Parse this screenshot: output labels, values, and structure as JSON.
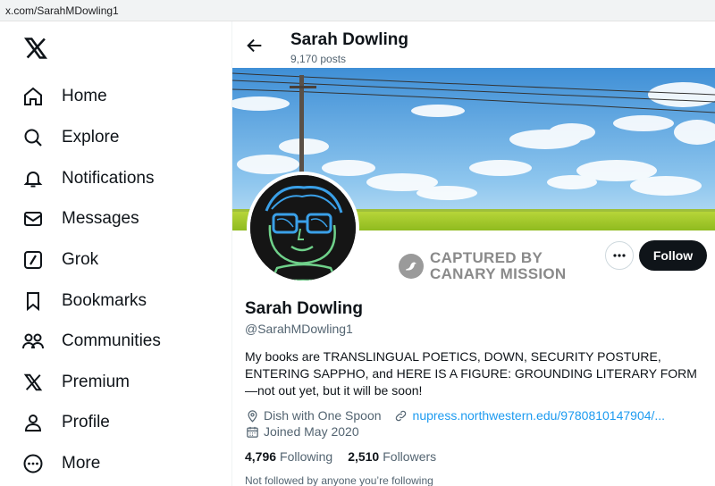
{
  "browser": {
    "url": "x.com/SarahMDowling1"
  },
  "sidebar": {
    "logo": "x-logo-icon",
    "items": [
      {
        "label": "Home",
        "icon": "home-icon"
      },
      {
        "label": "Explore",
        "icon": "search-icon"
      },
      {
        "label": "Notifications",
        "icon": "bell-icon"
      },
      {
        "label": "Messages",
        "icon": "envelope-icon"
      },
      {
        "label": "Grok",
        "icon": "grok-icon"
      },
      {
        "label": "Bookmarks",
        "icon": "bookmark-icon"
      },
      {
        "label": "Communities",
        "icon": "communities-icon"
      },
      {
        "label": "Premium",
        "icon": "x-logo-icon"
      },
      {
        "label": "Profile",
        "icon": "person-icon"
      },
      {
        "label": "More",
        "icon": "more-circle-icon"
      }
    ]
  },
  "header": {
    "name": "Sarah Dowling",
    "posts": "9,170 posts"
  },
  "profile": {
    "name": "Sarah Dowling",
    "handle": "@SarahMDowling1",
    "bio": "My books are TRANSLINGUAL POETICS, DOWN, SECURITY POSTURE, ENTERING SAPPHO, and HERE IS A FIGURE: GROUNDING LITERARY FORM—not out yet, but it will be soon!",
    "location": "Dish with One Spoon",
    "website": "nupress.northwestern.edu/9780810147904/...",
    "joined": "Joined May 2020",
    "following_count": "4,796",
    "following_label": "Following",
    "followers_count": "2,510",
    "followers_label": "Followers",
    "not_followed": "Not followed by anyone you’re following",
    "follow_button": "Follow"
  },
  "overlay_stamp": {
    "line1": "CAPTURED BY",
    "line2": "CANARY MISSION"
  },
  "colors": {
    "accent": "#1d9bf0",
    "text": "#0f1419",
    "muted": "#536471",
    "follow_bg": "#0f1419"
  }
}
